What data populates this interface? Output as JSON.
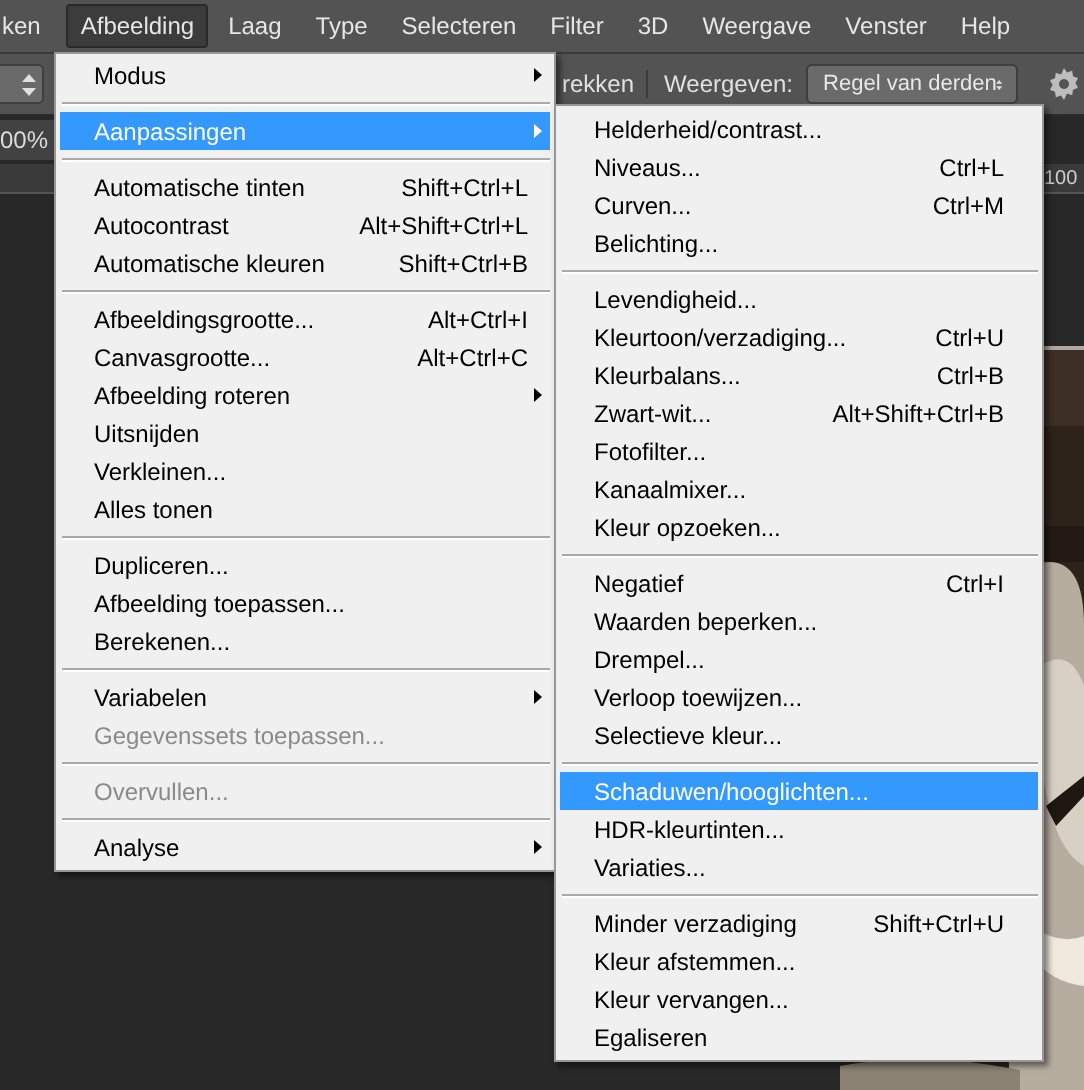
{
  "menu_bar": {
    "items": [
      {
        "label": "ken",
        "selected": false
      },
      {
        "label": "Afbeelding",
        "selected": true
      },
      {
        "label": "Laag",
        "selected": false
      },
      {
        "label": "Type",
        "selected": false
      },
      {
        "label": "Selecteren",
        "selected": false
      },
      {
        "label": "Filter",
        "selected": false
      },
      {
        "label": "3D",
        "selected": false
      },
      {
        "label": "Weergave",
        "selected": false
      },
      {
        "label": "Venster",
        "selected": false
      },
      {
        "label": "Help",
        "selected": false
      }
    ]
  },
  "options_bar": {
    "straighten_label": "rekken",
    "view_label": "Weergeven:",
    "view_select": "Regel van derden"
  },
  "document_tab": {
    "title": "00%"
  },
  "ruler": {
    "label": "100"
  },
  "menu": {
    "items": [
      {
        "kind": "item",
        "label": "Modus",
        "submenu": true,
        "selected": false,
        "disabled": false
      },
      {
        "kind": "separator"
      },
      {
        "kind": "item",
        "label": "Aanpassingen",
        "submenu": true,
        "selected": true,
        "disabled": false
      },
      {
        "kind": "separator"
      },
      {
        "kind": "item",
        "label": "Automatische tinten",
        "shortcut": "Shift+Ctrl+L",
        "submenu": false,
        "selected": false,
        "disabled": false
      },
      {
        "kind": "item",
        "label": "Autocontrast",
        "shortcut": "Alt+Shift+Ctrl+L",
        "submenu": false,
        "selected": false,
        "disabled": false
      },
      {
        "kind": "item",
        "label": "Automatische kleuren",
        "shortcut": "Shift+Ctrl+B",
        "submenu": false,
        "selected": false,
        "disabled": false
      },
      {
        "kind": "separator"
      },
      {
        "kind": "item",
        "label": "Afbeeldingsgrootte...",
        "shortcut": "Alt+Ctrl+I",
        "submenu": false,
        "selected": false,
        "disabled": false
      },
      {
        "kind": "item",
        "label": "Canvasgrootte...",
        "shortcut": "Alt+Ctrl+C",
        "submenu": false,
        "selected": false,
        "disabled": false
      },
      {
        "kind": "item",
        "label": "Afbeelding roteren",
        "submenu": true,
        "selected": false,
        "disabled": false
      },
      {
        "kind": "item",
        "label": "Uitsnijden",
        "submenu": false,
        "selected": false,
        "disabled": false
      },
      {
        "kind": "item",
        "label": "Verkleinen...",
        "submenu": false,
        "selected": false,
        "disabled": false
      },
      {
        "kind": "item",
        "label": "Alles tonen",
        "submenu": false,
        "selected": false,
        "disabled": false
      },
      {
        "kind": "separator"
      },
      {
        "kind": "item",
        "label": "Dupliceren...",
        "submenu": false,
        "selected": false,
        "disabled": false
      },
      {
        "kind": "item",
        "label": "Afbeelding toepassen...",
        "submenu": false,
        "selected": false,
        "disabled": false
      },
      {
        "kind": "item",
        "label": "Berekenen...",
        "submenu": false,
        "selected": false,
        "disabled": false
      },
      {
        "kind": "separator"
      },
      {
        "kind": "item",
        "label": "Variabelen",
        "submenu": true,
        "selected": false,
        "disabled": false
      },
      {
        "kind": "item",
        "label": "Gegevenssets toepassen...",
        "submenu": false,
        "selected": false,
        "disabled": true
      },
      {
        "kind": "separator"
      },
      {
        "kind": "item",
        "label": "Overvullen...",
        "submenu": false,
        "selected": false,
        "disabled": true
      },
      {
        "kind": "separator"
      },
      {
        "kind": "item",
        "label": "Analyse",
        "submenu": true,
        "selected": false,
        "disabled": false
      }
    ]
  },
  "submenu": {
    "items": [
      {
        "kind": "item",
        "label": "Helderheid/contrast...",
        "submenu": false,
        "selected": false,
        "disabled": false
      },
      {
        "kind": "item",
        "label": "Niveaus...",
        "shortcut": "Ctrl+L",
        "submenu": false,
        "selected": false,
        "disabled": false
      },
      {
        "kind": "item",
        "label": "Curven...",
        "shortcut": "Ctrl+M",
        "submenu": false,
        "selected": false,
        "disabled": false
      },
      {
        "kind": "item",
        "label": "Belichting...",
        "submenu": false,
        "selected": false,
        "disabled": false
      },
      {
        "kind": "separator"
      },
      {
        "kind": "item",
        "label": "Levendigheid...",
        "submenu": false,
        "selected": false,
        "disabled": false
      },
      {
        "kind": "item",
        "label": "Kleurtoon/verzadiging...",
        "shortcut": "Ctrl+U",
        "submenu": false,
        "selected": false,
        "disabled": false
      },
      {
        "kind": "item",
        "label": "Kleurbalans...",
        "shortcut": "Ctrl+B",
        "submenu": false,
        "selected": false,
        "disabled": false
      },
      {
        "kind": "item",
        "label": "Zwart-wit...",
        "shortcut": "Alt+Shift+Ctrl+B",
        "submenu": false,
        "selected": false,
        "disabled": false
      },
      {
        "kind": "item",
        "label": "Fotofilter...",
        "submenu": false,
        "selected": false,
        "disabled": false
      },
      {
        "kind": "item",
        "label": "Kanaalmixer...",
        "submenu": false,
        "selected": false,
        "disabled": false
      },
      {
        "kind": "item",
        "label": "Kleur opzoeken...",
        "submenu": false,
        "selected": false,
        "disabled": false
      },
      {
        "kind": "separator"
      },
      {
        "kind": "item",
        "label": "Negatief",
        "shortcut": "Ctrl+I",
        "submenu": false,
        "selected": false,
        "disabled": false
      },
      {
        "kind": "item",
        "label": "Waarden beperken...",
        "submenu": false,
        "selected": false,
        "disabled": false
      },
      {
        "kind": "item",
        "label": "Drempel...",
        "submenu": false,
        "selected": false,
        "disabled": false
      },
      {
        "kind": "item",
        "label": "Verloop toewijzen...",
        "submenu": false,
        "selected": false,
        "disabled": false
      },
      {
        "kind": "item",
        "label": "Selectieve kleur...",
        "submenu": false,
        "selected": false,
        "disabled": false
      },
      {
        "kind": "separator"
      },
      {
        "kind": "item",
        "label": "Schaduwen/hooglichten...",
        "submenu": false,
        "selected": true,
        "disabled": false
      },
      {
        "kind": "item",
        "label": "HDR-kleurtinten...",
        "submenu": false,
        "selected": false,
        "disabled": false
      },
      {
        "kind": "item",
        "label": "Variaties...",
        "submenu": false,
        "selected": false,
        "disabled": false
      },
      {
        "kind": "separator"
      },
      {
        "kind": "item",
        "label": "Minder verzadiging",
        "shortcut": "Shift+Ctrl+U",
        "submenu": false,
        "selected": false,
        "disabled": false
      },
      {
        "kind": "item",
        "label": "Kleur afstemmen...",
        "submenu": false,
        "selected": false,
        "disabled": false
      },
      {
        "kind": "item",
        "label": "Kleur vervangen...",
        "submenu": false,
        "selected": false,
        "disabled": false
      },
      {
        "kind": "item",
        "label": "Egaliseren",
        "submenu": false,
        "selected": false,
        "disabled": false
      }
    ]
  }
}
